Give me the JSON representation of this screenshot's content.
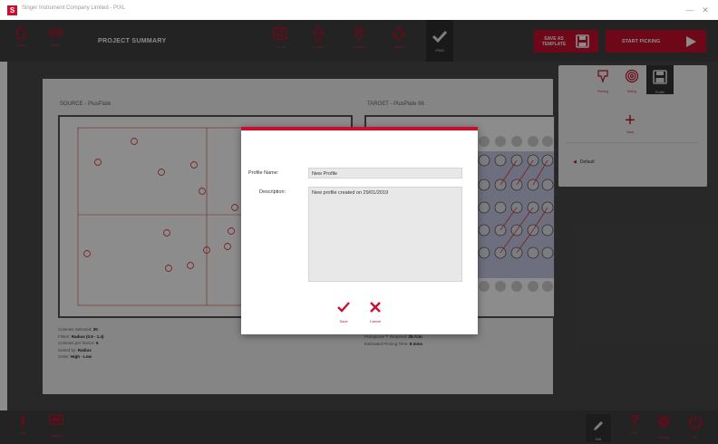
{
  "window": {
    "title": "Singer Instrument Company Limited - PIXL",
    "logo": "S",
    "minimize": "—",
    "close": "✕"
  },
  "topbar": {
    "home_label": "Home",
    "back_label": "Back",
    "page_title": "PROJECT SUMMARY",
    "steps": [
      {
        "label": "Set up"
      },
      {
        "label": "Source"
      },
      {
        "label": "Colonies"
      },
      {
        "label": "Target"
      },
      {
        "label": "PINS"
      }
    ],
    "save_template": "SAVE AS TEMPLATE",
    "start_picking": "START PICKING"
  },
  "summary": {
    "source_label": "SOURCE - PlusPlate",
    "target_label": "TARGET - PlusPlate 96",
    "left_info": [
      {
        "k": "Colonies Selected:",
        "v": "20"
      },
      {
        "k": "Filters:",
        "v": "Radius (0.9 - 1.4)"
      },
      {
        "k": "Colonies per Sector:",
        "v": "5"
      },
      {
        "k": "Sorted by:",
        "v": "Radius"
      },
      {
        "k": "Order:",
        "v": "High - Low"
      }
    ],
    "right_info": [
      {
        "k": "PickupLine™ Required:",
        "v": "25.7cm"
      },
      {
        "k": "Estimated Pinning Time:",
        "v": "8 mins"
      }
    ]
  },
  "right_panel": {
    "tabs": [
      {
        "label": "Pinning"
      },
      {
        "label": "Mixing"
      },
      {
        "label": "Profile"
      }
    ],
    "new_label": "New",
    "default_item": "Default"
  },
  "bottombar": {
    "info_label": "Info",
    "labware_label": "Labware",
    "edit_label": "Edit",
    "help_label": "Help",
    "settings_label": "Settings",
    "off_label": "Off"
  },
  "dialog": {
    "profile_name_label": "Profile Name:",
    "profile_name_value": "New Profile",
    "description_label": "Description:",
    "description_value": "New profile created on 29/01/2019",
    "save_label": "Save",
    "cancel_label": "Cancel"
  },
  "colors": {
    "accent": "#c8102e",
    "bar": "#404040",
    "panel": "#4a4a4a"
  }
}
